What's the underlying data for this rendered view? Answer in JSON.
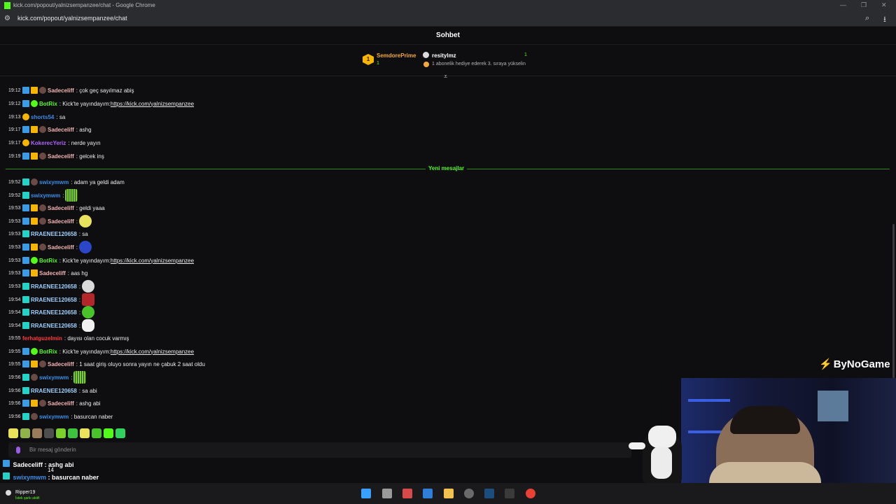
{
  "browser": {
    "title": "kick.com/popout/yalnizsempanzee/chat - Google Chrome",
    "url": "kick.com/popout/yalnizsempanzee/chat"
  },
  "chat": {
    "header": "Sohbet",
    "leaderboard": {
      "rank": "1",
      "first_name": "SemdorePrime",
      "first_count": "1",
      "second_name": "resitylmz",
      "second_count": "1",
      "hint": "1 abonelik hediye ederek 3. sıraya yükselin"
    },
    "separator": "Yeni mesajlar",
    "input_placeholder": "Bir mesaj gönderin",
    "messages": [
      {
        "ts": "19:12",
        "user": "Sadeceliff",
        "text": "çok geç sayılmaz abiş"
      },
      {
        "ts": "19:12",
        "user": "BotRix",
        "text": "Kick'te yayındayım: ",
        "link": "https://kick.com/yalnizsempanzee"
      },
      {
        "ts": "19:13",
        "user": "shorts54",
        "text": "sa"
      },
      {
        "ts": "19:17",
        "user": "Sadeceliff",
        "text": "ashg"
      },
      {
        "ts": "19:17",
        "user": "KokerecYeriz",
        "text": "nerde yayın"
      },
      {
        "ts": "19:19",
        "user": "Sadeceliff",
        "text": "gelcek inş"
      },
      {
        "ts": "19:52",
        "user": "swixymwm",
        "text": "adam ya geldi adam"
      },
      {
        "ts": "19:52",
        "user": "swixymwm",
        "text": ""
      },
      {
        "ts": "19:53",
        "user": "Sadeceliff",
        "text": "geldi yaaa"
      },
      {
        "ts": "19:53",
        "user": "Sadeceliff",
        "text": ""
      },
      {
        "ts": "19:53",
        "user": "RRAENEE120658",
        "text": "sa"
      },
      {
        "ts": "19:53",
        "user": "Sadeceliff",
        "text": ""
      },
      {
        "ts": "19:53",
        "user": "BotRix",
        "text": "Kick'te yayındayım: ",
        "link": "https://kick.com/yalnizsempanzee"
      },
      {
        "ts": "19:53",
        "user": "Sadeceliff",
        "text": "aas hg"
      },
      {
        "ts": "19:53",
        "user": "RRAENEE120658",
        "text": ""
      },
      {
        "ts": "19:54",
        "user": "RRAENEE120658",
        "text": ""
      },
      {
        "ts": "19:54",
        "user": "RRAENEE120658",
        "text": ""
      },
      {
        "ts": "19:54",
        "user": "RRAENEE120658",
        "text": ""
      },
      {
        "ts": "19:55",
        "user": "ferhatguzelmin",
        "text": "dayısı olan cocuk varmış"
      },
      {
        "ts": "19:55",
        "user": "BotRix",
        "text": "Kick'te yayındayım: ",
        "link": "https://kick.com/yalnizsempanzee"
      },
      {
        "ts": "19:55",
        "user": "Sadeceliff",
        "text": "1 saat giriş oluyo sonra yayın ne çabuk 2 saat oldu"
      },
      {
        "ts": "19:56",
        "user": "swixymwm",
        "text": ""
      },
      {
        "ts": "19:56",
        "user": "RRAENEE120658",
        "text": "sa abi"
      },
      {
        "ts": "19:56",
        "user": "Sadeceliff",
        "text": "ashg abi"
      },
      {
        "ts": "19:56",
        "user": "swixymwm",
        "text": "basurcan naber"
      }
    ]
  },
  "overlay": {
    "line1_user": "Sadeceliff",
    "line1_text": " : ashg abi",
    "line2_user": "swixymwm",
    "line2_text": " : basurcan naber",
    "mid_text": "14"
  },
  "taskbar": {
    "user": "Ripper19",
    "sub": "İstek şarkı aktifi"
  },
  "stream": {
    "brand": "ByNoGame"
  },
  "colors": {
    "kick_green": "#53fc18",
    "mod_blue": "#3a9be6",
    "crown_gold": "#f7b500",
    "sub_teal": "#24d3c8",
    "name_sadeceliff": "#f2b3b3",
    "name_botrix": "#53fc18",
    "name_blue": "#3a8ee6",
    "name_purple": "#b066ff",
    "name_rraenee": "#9fd0ff",
    "name_red": "#ff3b3b"
  }
}
